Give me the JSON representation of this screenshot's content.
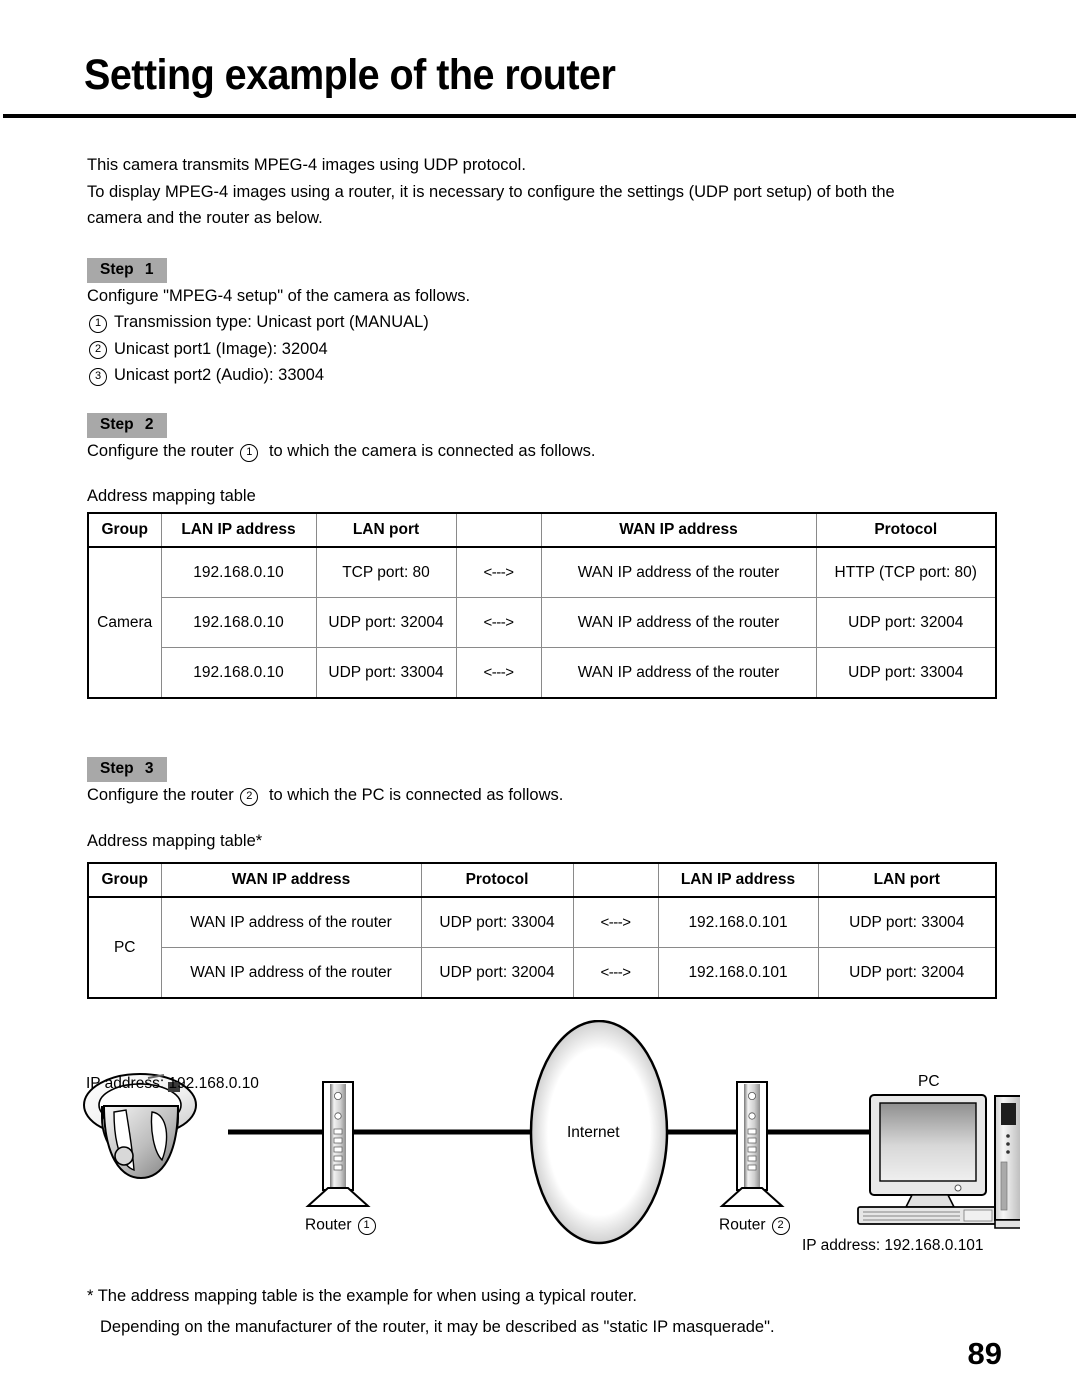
{
  "page": {
    "title": "Setting example of the router",
    "number": "89"
  },
  "intro": {
    "line1": "This camera transmits MPEG-4 images using UDP protocol.",
    "line2": "To display MPEG-4 images using a router, it is necessary to configure the settings (UDP port setup) of both the",
    "line3": "camera and the router as below."
  },
  "steps": [
    {
      "badge_word": "Step",
      "badge_num": "1",
      "body_before": "Configure \"MPEG-4 setup\" of the camera as follows.",
      "items": [
        {
          "marker": "1",
          "text": "Transmission type: Unicast port (MANUAL)"
        },
        {
          "marker": "2",
          "text": "Unicast port1 (Image): 32004"
        },
        {
          "marker": "3",
          "text": "Unicast port2 (Audio): 33004"
        }
      ]
    },
    {
      "badge_word": "Step",
      "badge_num": "2",
      "body_pre": "Configure the router",
      "body_marker": "1",
      "body_post": "to which the camera is connected as follows.",
      "table_caption": "Address mapping table"
    },
    {
      "badge_word": "Step",
      "badge_num": "3",
      "body_pre": "Configure the router",
      "body_marker": "2",
      "body_post": "to which the PC is connected as follows.",
      "table_caption": "Address mapping table*"
    }
  ],
  "table_camera": {
    "headers": [
      "Group",
      "LAN IP address",
      "LAN port",
      "",
      "WAN IP address",
      "Protocol"
    ],
    "group_label": "Camera",
    "rows": [
      {
        "lan_ip": "192.168.0.10",
        "lan_port": "TCP port: 80",
        "arrow": "<--->",
        "wan_ip": "WAN IP address of the router",
        "protocol": "HTTP (TCP port: 80)"
      },
      {
        "lan_ip": "192.168.0.10",
        "lan_port": "UDP port: 32004",
        "arrow": "<--->",
        "wan_ip": "WAN IP address of the router",
        "protocol": "UDP port: 32004"
      },
      {
        "lan_ip": "192.168.0.10",
        "lan_port": "UDP port: 33004",
        "arrow": "<--->",
        "wan_ip": "WAN IP address of the router",
        "protocol": "UDP port: 33004"
      }
    ]
  },
  "table_pc": {
    "headers": [
      "Group",
      "WAN IP address",
      "Protocol",
      "",
      "LAN IP address",
      "LAN port"
    ],
    "group_label": "PC",
    "rows": [
      {
        "wan_ip": "WAN IP address of the router",
        "protocol": "UDP port: 33004",
        "arrow": "<--->",
        "lan_ip": "192.168.0.101",
        "lan_port": "UDP port: 33004"
      },
      {
        "wan_ip": "WAN IP address of the router",
        "protocol": "UDP port: 32004",
        "arrow": "<--->",
        "lan_ip": "192.168.0.101",
        "lan_port": "UDP port: 32004"
      }
    ]
  },
  "diagram": {
    "camera_ip_label": "IP address: 192.168.0.10",
    "router1_label": "Router",
    "router1_marker": "1",
    "internet_label": "Internet",
    "router2_label": "Router",
    "router2_marker": "2",
    "pc_label": "PC",
    "pc_ip_label": "IP address: 192.168.0.101"
  },
  "footnote": {
    "line1": "* The address mapping table is the example for when using a typical router.",
    "line2": "Depending on the manufacturer of the router, it may be described as \"static IP masquerade\"."
  }
}
